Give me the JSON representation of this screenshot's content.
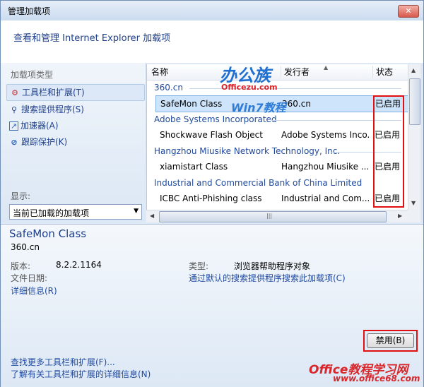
{
  "window": {
    "title": "管理加载项",
    "close_label": "✕"
  },
  "header": {
    "title": "查看和管理 Internet Explorer 加载项"
  },
  "sidebar": {
    "heading": "加载项类型",
    "items": [
      {
        "label": "工具栏和扩展(T)",
        "icon": "⚙"
      },
      {
        "label": "搜索提供程序(S)",
        "icon": "⚲"
      },
      {
        "label": "加速器(A)",
        "icon": "↗"
      },
      {
        "label": "跟踪保护(K)",
        "icon": "⊘"
      }
    ],
    "show_label": "显示:",
    "show_value": "当前已加载的加载项"
  },
  "list": {
    "columns": [
      "名称",
      "发行者",
      "状态"
    ],
    "groups": [
      {
        "name": "360.cn",
        "rows": [
          {
            "name": "SafeMon Class",
            "publisher": "360.cn",
            "status": "已启用"
          }
        ]
      },
      {
        "name": "Adobe Systems Incorporated",
        "rows": [
          {
            "name": "Shockwave Flash Object",
            "publisher": "Adobe Systems Inco...",
            "status": "已启用"
          }
        ]
      },
      {
        "name": "Hangzhou Miusike Network Technology, Inc.",
        "rows": [
          {
            "name": "xiamistart Class",
            "publisher": "Hangzhou Miusike ...",
            "status": "已启用"
          }
        ]
      },
      {
        "name": "Industrial and Commercial Bank of China Limited",
        "rows": [
          {
            "name": "ICBC Anti-Phishing class",
            "publisher": "Industrial and Com...",
            "status": "已启用"
          }
        ]
      }
    ]
  },
  "details": {
    "name": "SafeMon Class",
    "publisher": "360.cn",
    "version_label": "版本:",
    "version_value": "8.2.2.1164",
    "date_label": "文件日期:",
    "more_info": "详细信息(R)",
    "type_label": "类型:",
    "type_value": "浏览器帮助程序对象",
    "search_link": "通过默认的搜索提供程序搜索此加载项(C)",
    "disable_button": "禁用(B)",
    "find_more": "查找更多工具栏和扩展(F)...",
    "learn_more": "了解有关工具栏和扩展的详细信息(N)"
  },
  "watermark": {
    "logo_text": "办公族",
    "site_text": "Officezu.com",
    "win7_text": "Win7教程",
    "footer_text": "Office教程学习网",
    "footer_url": "www.office68.com"
  }
}
